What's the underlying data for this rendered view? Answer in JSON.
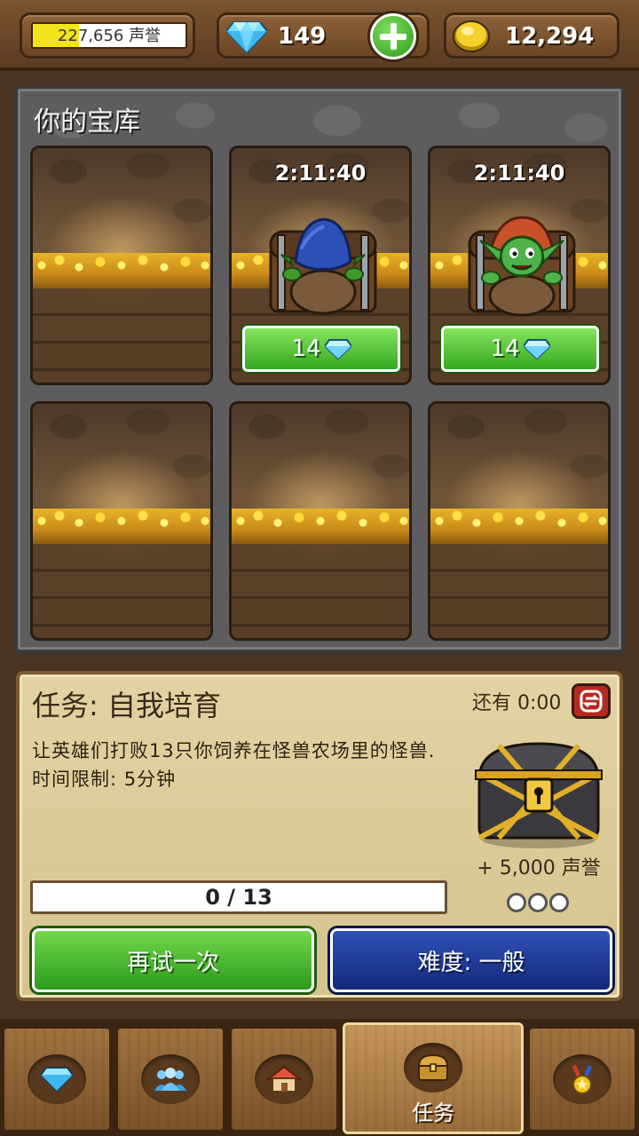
{
  "topbar": {
    "reputation_text": "227,656 声誉",
    "reputation_fraction": 0.3,
    "gems": "149",
    "gold": "12,294"
  },
  "vault": {
    "title": "你的宝库",
    "slots": [
      {
        "occupied": false,
        "timer": "",
        "cost": ""
      },
      {
        "occupied": true,
        "timer": "2:11:40",
        "cost": "14",
        "occupant": "blue-hooded-goblin"
      },
      {
        "occupied": true,
        "timer": "2:11:40",
        "cost": "14",
        "occupant": "red-hooded-goblin"
      },
      {
        "occupied": false,
        "timer": "",
        "cost": ""
      },
      {
        "occupied": false,
        "timer": "",
        "cost": ""
      },
      {
        "occupied": false,
        "timer": "",
        "cost": ""
      }
    ]
  },
  "quest": {
    "title": "任务: 自我培育",
    "remaining": "还有 0:00",
    "description": "让英雄们打败13只你饲养在怪兽农场里的怪兽. 时间限制: 5分钟",
    "reward": "+ 5,000 声誉",
    "progress_text": "0 / 13",
    "progress_fraction": 0,
    "retry_label": "再试一次",
    "difficulty_label": "难度: 一般"
  },
  "nav": {
    "tabs": [
      {
        "icon": "gem-icon",
        "label": ""
      },
      {
        "icon": "heroes-icon",
        "label": ""
      },
      {
        "icon": "house-icon",
        "label": ""
      },
      {
        "icon": "chest-icon",
        "label": "任务",
        "active": true
      },
      {
        "icon": "medal-icon",
        "label": ""
      }
    ]
  },
  "colors": {
    "wood": "#7b5329",
    "green_button": "#34a820",
    "blue_button": "#13297a",
    "parchment": "#d6c38e"
  }
}
